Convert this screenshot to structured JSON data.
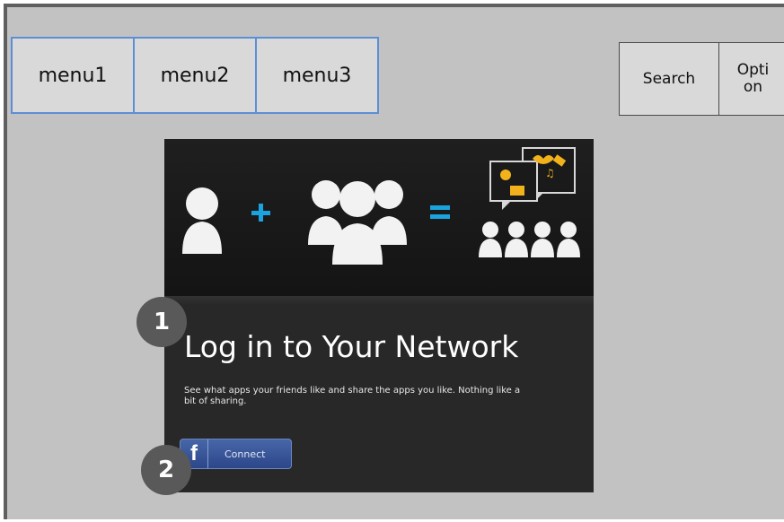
{
  "menu": {
    "items": [
      {
        "label": "menu1"
      },
      {
        "label": "menu2"
      },
      {
        "label": "menu3"
      }
    ]
  },
  "toolbar": {
    "search_label": "Search",
    "option_label_line1": "Opti",
    "option_label_line2": "on"
  },
  "hero": {
    "title": "Log in to Your Network",
    "description": "See what apps your friends like and share the apps you like. Nothing like a bit of sharing.",
    "facebook_button": {
      "icon_text": "f",
      "label": "Connect"
    },
    "colors": {
      "accent": "#1aa3df",
      "gold": "#f2b21c"
    }
  },
  "badges": [
    {
      "number": "1"
    },
    {
      "number": "2"
    }
  ]
}
